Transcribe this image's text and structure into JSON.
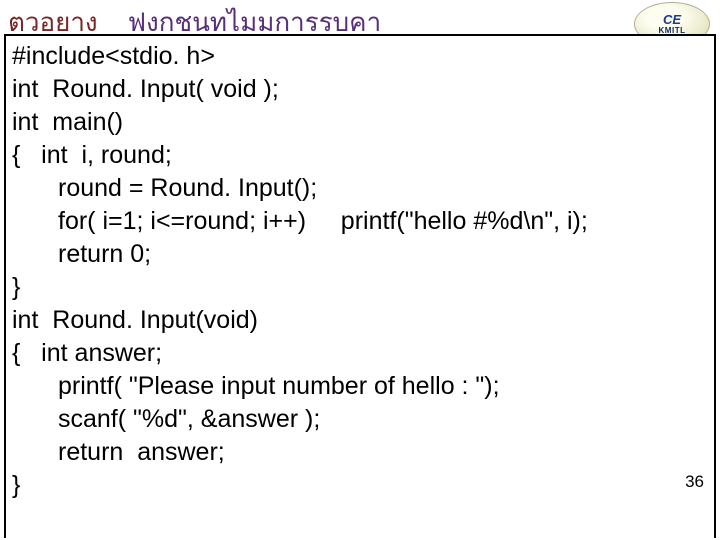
{
  "header": {
    "accent": "ตวอยาง",
    "title": "ฟงกชนทไมมการรบคา"
  },
  "logo": {
    "top": "CE",
    "bottom": "KMITL"
  },
  "code": {
    "l1": "#include<stdio. h>",
    "l2": "int  Round. Input( void );",
    "l3": "int  main()",
    "l4": "{   int  i, round;",
    "l5": "round = Round. Input();",
    "l6a": "for( i=1; i<=round; i++)",
    "l6b": "printf(\"hello #%d\\n\", i);",
    "l7": "return 0;",
    "l8": "}",
    "l9": "int  Round. Input(void)",
    "l10": "{   int answer;",
    "l11": "printf( \"Please input number of hello : \");",
    "l12": "scanf( \"%d\", &answer );",
    "l13": "return  answer;",
    "l14": "}"
  },
  "page_number": "36"
}
